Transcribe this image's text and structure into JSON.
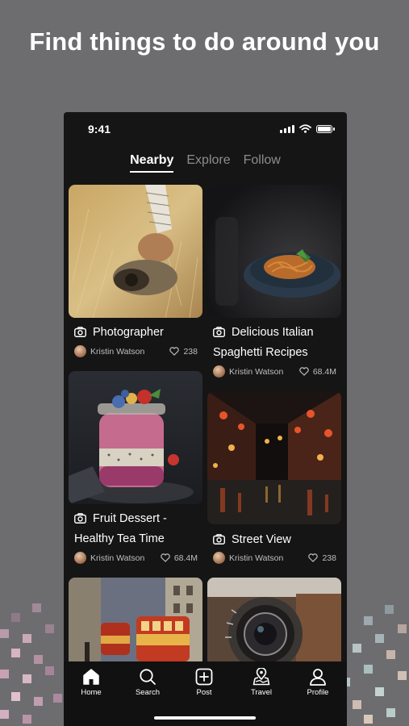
{
  "headline": "Find things to do around you",
  "status_bar": {
    "time": "9:41"
  },
  "tabs": [
    {
      "label": "Nearby",
      "active": true
    },
    {
      "label": "Explore",
      "active": false
    },
    {
      "label": "Follow",
      "active": false
    }
  ],
  "cards": [
    {
      "title_line1": "Photographer",
      "title_line2": "",
      "author": "Kristin Watson",
      "likes": "238"
    },
    {
      "title_line1": "Delicious Italian",
      "title_line2": "Spaghetti Recipes",
      "author": "Kristin Watson",
      "likes": "68.4M"
    },
    {
      "title_line1": "Fruit Dessert -",
      "title_line2": "Healthy Tea Time",
      "author": "Kristin Watson",
      "likes": "68.4M"
    },
    {
      "title_line1": "Street View",
      "title_line2": "",
      "author": "Kristin Watson",
      "likes": "238"
    }
  ],
  "nav": [
    {
      "label": "Home",
      "icon": "home-icon",
      "active": true
    },
    {
      "label": "Search",
      "icon": "search-icon",
      "active": false
    },
    {
      "label": "Post",
      "icon": "plus-square-icon",
      "active": false
    },
    {
      "label": "Travel",
      "icon": "map-pin-icon",
      "active": false
    },
    {
      "label": "Profile",
      "icon": "user-icon",
      "active": false
    }
  ],
  "colors": {
    "background": "#6d6d6f",
    "phone": "#151515",
    "navbar": "#111111",
    "text": "#ffffff",
    "muted": "#8d8d8d"
  }
}
